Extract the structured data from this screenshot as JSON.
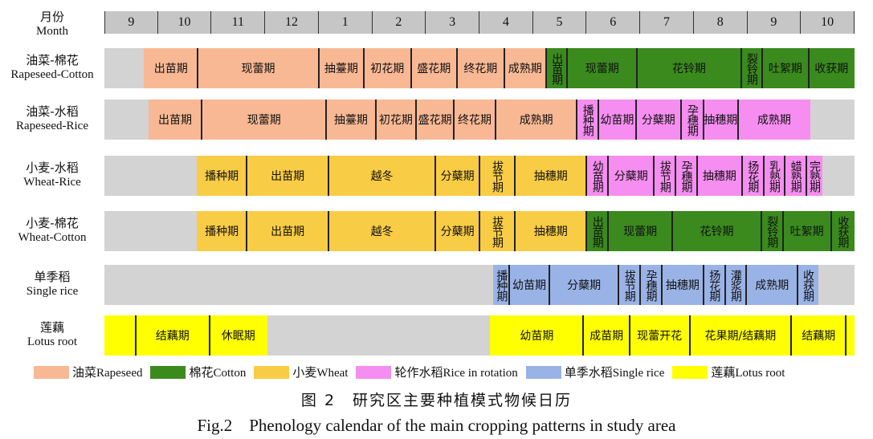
{
  "month_header": {
    "label_cn": "月份",
    "label_en": "Month",
    "months": [
      "9",
      "10",
      "11",
      "12",
      "1",
      "2",
      "3",
      "4",
      "5",
      "6",
      "7",
      "8",
      "9",
      "10"
    ]
  },
  "rows": [
    {
      "name_cn": "油菜-棉花",
      "name_en": "Rapeseed-Cotton",
      "segments": [
        {
          "label": "出苗期",
          "color": "#f8b894",
          "start": 0.74,
          "end": 1.74
        },
        {
          "label": "现蕾期",
          "color": "#f8b894",
          "start": 1.74,
          "end": 4.0
        },
        {
          "label": "抽薹期",
          "color": "#f8b894",
          "start": 4.0,
          "end": 4.84
        },
        {
          "label": "初花期",
          "color": "#f8b894",
          "start": 4.84,
          "end": 5.72
        },
        {
          "label": "盛花期",
          "color": "#f8b894",
          "start": 5.72,
          "end": 6.58
        },
        {
          "label": "终花期",
          "color": "#f8b894",
          "start": 6.58,
          "end": 7.46
        },
        {
          "label": "成熟期",
          "color": "#f8b894",
          "start": 7.46,
          "end": 8.24
        },
        {
          "label": "出苗期",
          "color": "#3a8a1e",
          "start": 8.24,
          "end": 8.64,
          "vertical": true
        },
        {
          "label": "现蕾期",
          "color": "#3a8a1e",
          "start": 8.64,
          "end": 9.94
        },
        {
          "label": "花铃期",
          "color": "#3a8a1e",
          "start": 9.94,
          "end": 11.88
        },
        {
          "label": "裂铃期",
          "color": "#3a8a1e",
          "start": 11.88,
          "end": 12.28,
          "vertical": true
        },
        {
          "label": "吐絮期",
          "color": "#3a8a1e",
          "start": 12.28,
          "end": 13.14
        },
        {
          "label": "收获期",
          "color": "#3a8a1e",
          "start": 13.14,
          "end": 14.0
        }
      ]
    },
    {
      "name_cn": "油菜-水稻",
      "name_en": "Rapeseed-Rice",
      "segments": [
        {
          "label": "出苗期",
          "color": "#f8b894",
          "start": 0.82,
          "end": 1.82
        },
        {
          "label": "现蕾期",
          "color": "#f8b894",
          "start": 1.82,
          "end": 4.14
        },
        {
          "label": "抽薹期",
          "color": "#f8b894",
          "start": 4.14,
          "end": 5.06
        },
        {
          "label": "初花期",
          "color": "#f8b894",
          "start": 5.06,
          "end": 5.82
        },
        {
          "label": "盛花期",
          "color": "#f8b894",
          "start": 5.82,
          "end": 6.52
        },
        {
          "label": "终花期",
          "color": "#f8b894",
          "start": 6.52,
          "end": 7.3
        },
        {
          "label": "成熟期",
          "color": "#f8b894",
          "start": 7.3,
          "end": 8.82
        },
        {
          "label": "播种期",
          "color": "#f58ef0",
          "start": 8.82,
          "end": 9.22,
          "vertical": true
        },
        {
          "label": "幼苗期",
          "color": "#f58ef0",
          "start": 9.22,
          "end": 9.92
        },
        {
          "label": "分蘖期",
          "color": "#f58ef0",
          "start": 9.92,
          "end": 10.76
        },
        {
          "label": "孕穗期",
          "color": "#f58ef0",
          "start": 10.76,
          "end": 11.18,
          "vertical": true
        },
        {
          "label": "抽穗期",
          "color": "#f58ef0",
          "start": 11.18,
          "end": 11.82
        },
        {
          "label": "成熟期",
          "color": "#f58ef0",
          "start": 11.82,
          "end": 13.18
        }
      ]
    },
    {
      "name_cn": "小麦-水稻",
      "name_en": "Wheat-Rice",
      "segments": [
        {
          "label": "播种期",
          "color": "#f9cc45",
          "start": 1.72,
          "end": 2.66
        },
        {
          "label": "出苗期",
          "color": "#f9cc45",
          "start": 2.66,
          "end": 4.18
        },
        {
          "label": "越冬",
          "color": "#f9cc45",
          "start": 4.18,
          "end": 6.18
        },
        {
          "label": "分蘖期",
          "color": "#f9cc45",
          "start": 6.18,
          "end": 7.0
        },
        {
          "label": "拔节期",
          "color": "#f9cc45",
          "start": 7.0,
          "end": 7.66,
          "vertical": true
        },
        {
          "label": "抽穗期",
          "color": "#f9cc45",
          "start": 7.66,
          "end": 9.0
        },
        {
          "label": "幼苗期",
          "color": "#f58ef0",
          "start": 9.0,
          "end": 9.4,
          "vertical": true
        },
        {
          "label": "分蘖期",
          "color": "#f58ef0",
          "start": 9.4,
          "end": 10.26
        },
        {
          "label": "拔节期",
          "color": "#f58ef0",
          "start": 10.26,
          "end": 10.66,
          "vertical": true
        },
        {
          "label": "孕穗期",
          "color": "#f58ef0",
          "start": 10.66,
          "end": 11.06,
          "vertical": true
        },
        {
          "label": "抽穗期",
          "color": "#f58ef0",
          "start": 11.06,
          "end": 11.9
        },
        {
          "label": "扬花期",
          "color": "#f58ef0",
          "start": 11.9,
          "end": 12.3,
          "vertical": true
        },
        {
          "label": "乳熟期",
          "color": "#f58ef0",
          "start": 12.3,
          "end": 12.7,
          "vertical": true
        },
        {
          "label": "蜡熟期",
          "color": "#f58ef0",
          "start": 12.7,
          "end": 13.1,
          "vertical": true
        },
        {
          "label": "完熟期",
          "color": "#f58ef0",
          "start": 13.1,
          "end": 13.4,
          "vertical": true
        }
      ]
    },
    {
      "name_cn": "小麦-棉花",
      "name_en": "Wheat-Cotton",
      "segments": [
        {
          "label": "播种期",
          "color": "#f9cc45",
          "start": 1.72,
          "end": 2.66
        },
        {
          "label": "出苗期",
          "color": "#f9cc45",
          "start": 2.66,
          "end": 4.18
        },
        {
          "label": "越冬",
          "color": "#f9cc45",
          "start": 4.18,
          "end": 6.18
        },
        {
          "label": "分蘖期",
          "color": "#f9cc45",
          "start": 6.18,
          "end": 7.0
        },
        {
          "label": "拔节期",
          "color": "#f9cc45",
          "start": 7.0,
          "end": 7.66,
          "vertical": true
        },
        {
          "label": "抽穗期",
          "color": "#f9cc45",
          "start": 7.66,
          "end": 9.0
        },
        {
          "label": "出苗期",
          "color": "#3a8a1e",
          "start": 9.0,
          "end": 9.4,
          "vertical": true
        },
        {
          "label": "现蕾期",
          "color": "#3a8a1e",
          "start": 9.4,
          "end": 10.6
        },
        {
          "label": "花铃期",
          "color": "#3a8a1e",
          "start": 10.6,
          "end": 12.26
        },
        {
          "label": "裂铃期",
          "color": "#3a8a1e",
          "start": 12.26,
          "end": 12.66,
          "vertical": true
        },
        {
          "label": "吐絮期",
          "color": "#3a8a1e",
          "start": 12.66,
          "end": 13.56
        },
        {
          "label": "收获期",
          "color": "#3a8a1e",
          "start": 13.56,
          "end": 14.0,
          "vertical": true
        }
      ]
    },
    {
      "name_cn": "单季稻",
      "name_en": "Single rice",
      "segments": [
        {
          "label": "播种期",
          "color": "#9ab3e6",
          "start": 7.26,
          "end": 7.56,
          "vertical": true
        },
        {
          "label": "幼苗期",
          "color": "#9ab3e6",
          "start": 7.56,
          "end": 8.3
        },
        {
          "label": "分蘖期",
          "color": "#9ab3e6",
          "start": 8.3,
          "end": 9.6
        },
        {
          "label": "拔节期",
          "color": "#9ab3e6",
          "start": 9.6,
          "end": 10.0,
          "vertical": true
        },
        {
          "label": "孕穗期",
          "color": "#9ab3e6",
          "start": 10.0,
          "end": 10.4,
          "vertical": true
        },
        {
          "label": "抽穗期",
          "color": "#9ab3e6",
          "start": 10.4,
          "end": 11.18
        },
        {
          "label": "扬花期",
          "color": "#9ab3e6",
          "start": 11.18,
          "end": 11.58,
          "vertical": true
        },
        {
          "label": "灌浆期",
          "color": "#9ab3e6",
          "start": 11.58,
          "end": 11.98,
          "vertical": true
        },
        {
          "label": "成熟期",
          "color": "#9ab3e6",
          "start": 11.98,
          "end": 12.94
        },
        {
          "label": "收获期",
          "color": "#9ab3e6",
          "start": 12.94,
          "end": 13.32,
          "vertical": true
        }
      ]
    },
    {
      "name_cn": "莲藕",
      "name_en": "Lotus root",
      "segments": [
        {
          "label": "",
          "color": "#ffff00",
          "start": 0.0,
          "end": 0.58
        },
        {
          "label": "结藕期",
          "color": "#ffff00",
          "start": 0.58,
          "end": 1.96
        },
        {
          "label": "休眠期",
          "color": "#ffff00",
          "start": 1.96,
          "end": 3.04
        },
        {
          "label": "幼苗期",
          "color": "#ffff00",
          "start": 7.2,
          "end": 8.94
        },
        {
          "label": "成苗期",
          "color": "#ffff00",
          "start": 8.94,
          "end": 9.8
        },
        {
          "label": "现蕾开花",
          "color": "#ffff00",
          "start": 9.8,
          "end": 10.92
        },
        {
          "label": "花果期/结藕期",
          "color": "#ffff00",
          "start": 10.92,
          "end": 12.82
        },
        {
          "label": "结藕期",
          "color": "#ffff00",
          "start": 12.82,
          "end": 13.84
        },
        {
          "label": "",
          "color": "#ffff00",
          "start": 13.84,
          "end": 14.0
        }
      ]
    }
  ],
  "legend": [
    {
      "label": "油菜Rapeseed",
      "color": "#f8b894"
    },
    {
      "label": "棉花Cotton",
      "color": "#3a8a1e"
    },
    {
      "label": "小麦Wheat",
      "color": "#f9cc45"
    },
    {
      "label": "轮作水稻Rice in rotation",
      "color": "#f58ef0"
    },
    {
      "label": "单季水稻Single rice",
      "color": "#9ab3e6"
    },
    {
      "label": "莲藕Lotus root",
      "color": "#ffff00"
    }
  ],
  "caption_cn": "图 2　研究区主要种植模式物候日历",
  "caption_en": "Fig.2　Phenology calendar of the main cropping patterns in study area"
}
